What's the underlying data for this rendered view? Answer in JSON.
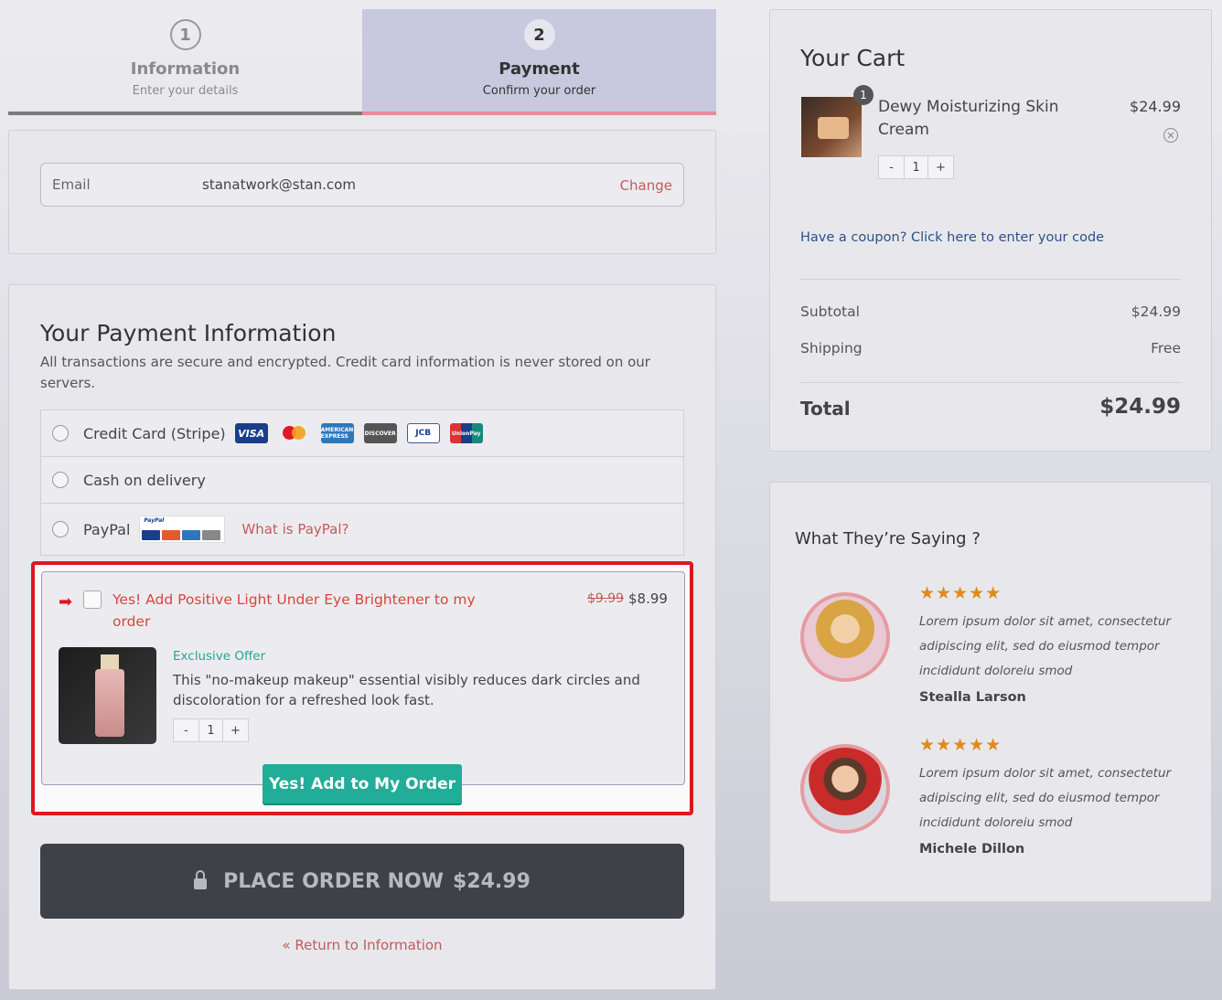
{
  "steps": [
    {
      "num": "1",
      "title": "Information",
      "sub": "Enter your details"
    },
    {
      "num": "2",
      "title": "Payment",
      "sub": "Confirm your order"
    }
  ],
  "contact": {
    "label": "Email",
    "value": "stanatwork@stan.com",
    "change": "Change"
  },
  "payment": {
    "title": "Your Payment Information",
    "desc": "All transactions are secure and encrypted. Credit card information is never stored on our servers.",
    "methods": [
      {
        "label": "Credit Card (Stripe)"
      },
      {
        "label": "Cash on delivery"
      },
      {
        "label": "PayPal",
        "link": "What is PayPal?"
      }
    ],
    "cards": [
      "VISA",
      "mastercard",
      "AMERICAN EXPRESS",
      "DISCOVER",
      "JCB",
      "UnionPay"
    ]
  },
  "upsell": {
    "title": "Yes! Add Positive Light Under Eye Brightener to my order",
    "old_price": "$9.99",
    "new_price": "$8.99",
    "tag": "Exclusive Offer",
    "desc": "This \"no-makeup makeup\" essential visibly reduces dark circles and discoloration for a refreshed look fast.",
    "qty": {
      "minus": "-",
      "value": "1",
      "plus": "+"
    },
    "button": "Yes! Add to My Order"
  },
  "place_order": {
    "label": "PLACE ORDER NOW",
    "price": "$24.99"
  },
  "return_link": "« Return to Information",
  "cart": {
    "title": "Your Cart",
    "item": {
      "badge": "1",
      "name": "Dewy Moisturizing Skin Cream",
      "price": "$24.99",
      "qty": {
        "minus": "-",
        "value": "1",
        "plus": "+"
      }
    },
    "coupon": "Have a coupon? Click here to enter your code",
    "subtotal_label": "Subtotal",
    "subtotal": "$24.99",
    "shipping_label": "Shipping",
    "shipping": "Free",
    "total_label": "Total",
    "total": "$24.99"
  },
  "testimonials": {
    "title": "What They’re Saying ?",
    "items": [
      {
        "stars": "★★★★★",
        "quote": "Lorem ipsum dolor sit amet, consectetur adipiscing elit, sed do eiusmod tempor incididunt doloreiu smod",
        "name": "Stealla Larson"
      },
      {
        "stars": "★★★★★",
        "quote": "Lorem ipsum dolor sit amet, consectetur adipiscing elit, sed do eiusmod tempor incididunt doloreiu smod",
        "name": "Michele Dillon"
      }
    ]
  },
  "colors": {
    "accent_red": "#e0161e",
    "teal": "#22ad98",
    "link_red": "#c45a5a",
    "dark_button": "#3e4147"
  }
}
